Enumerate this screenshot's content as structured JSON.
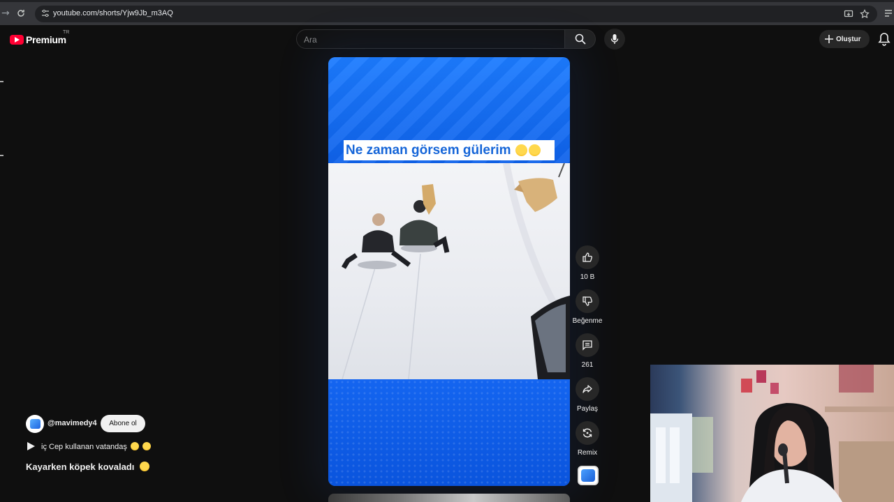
{
  "browser": {
    "url": "youtube.com/shorts/Yjw9Jb_m3AQ"
  },
  "header": {
    "logo_text": "Premium",
    "country_code": "TR",
    "search_placeholder": "Ara",
    "create_label": "Oluştur"
  },
  "short": {
    "caption": "Ne zaman görsem gülerim",
    "actions": {
      "like_count": "10 B",
      "dislike_label": "Beğenme",
      "comment_count": "261",
      "share_label": "Paylaş",
      "remix_label": "Remix"
    }
  },
  "channel": {
    "handle": "@mavimedy4",
    "subscribe_label": "Abone ol"
  },
  "sound": {
    "text": "iç Cep kullanan vatandaş"
  },
  "video_title": "Kayarken köpek kovaladı",
  "colors": {
    "background": "#0f0f0f",
    "short_blue": "#1a6ff0",
    "caption_text": "#1565d8",
    "brand_red": "#ff0033"
  },
  "icons": [
    "back-icon",
    "reload-icon",
    "site-settings-icon",
    "install-icon",
    "star-icon",
    "extensions-icon",
    "search-icon",
    "mic-icon",
    "plus-icon",
    "bell-icon",
    "thumbs-up-icon",
    "thumbs-down-icon",
    "comment-icon",
    "share-icon",
    "remix-icon",
    "play-icon"
  ]
}
